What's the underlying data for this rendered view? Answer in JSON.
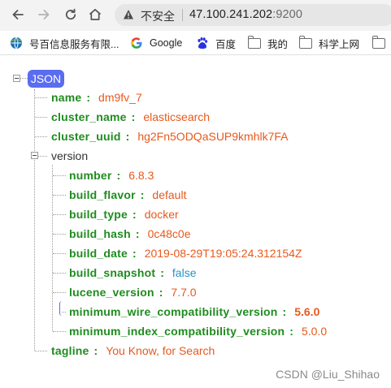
{
  "browser": {
    "security_label": "不安全",
    "url_host": "47.100.241.202",
    "url_port": ":9200"
  },
  "bookmarks": [
    {
      "label": "号百信息服务有限...",
      "icon": "company-globe-icon"
    },
    {
      "label": "Google",
      "icon": "google-icon"
    },
    {
      "label": "百度",
      "icon": "baidu-paw-icon"
    },
    {
      "label": "我的",
      "icon": "folder-icon"
    },
    {
      "label": "科学上网",
      "icon": "folder-icon"
    }
  ],
  "json_view": {
    "root_label": "JSON",
    "fields": [
      {
        "key": "name",
        "value": "dm9fv_7"
      },
      {
        "key": "cluster_name",
        "value": "elasticsearch"
      },
      {
        "key": "cluster_uuid",
        "value": "hg2Fn5ODQaSUP9kmhlk7FA"
      }
    ],
    "version_key": "version",
    "version_fields": [
      {
        "key": "number",
        "value": "6.8.3"
      },
      {
        "key": "build_flavor",
        "value": "default"
      },
      {
        "key": "build_type",
        "value": "docker"
      },
      {
        "key": "build_hash",
        "value": "0c48c0e"
      },
      {
        "key": "build_date",
        "value": "2019-08-29T19:05:24.312154Z"
      },
      {
        "key": "build_snapshot",
        "value": "false"
      },
      {
        "key": "lucene_version",
        "value": "7.7.0"
      },
      {
        "key": "minimum_wire_compatibility_version",
        "value": "5.6.0"
      },
      {
        "key": "minimum_index_compatibility_version",
        "value": "5.0.0"
      }
    ],
    "tagline": {
      "key": "tagline",
      "value": "You Know, for Search"
    }
  },
  "watermark": "CSDN @Liu_Shihao",
  "colors": {
    "key": "#1f8c1f",
    "string_value": "#e8591c",
    "boolean_value": "#2493c8",
    "root_badge": "#5a6cf0"
  }
}
